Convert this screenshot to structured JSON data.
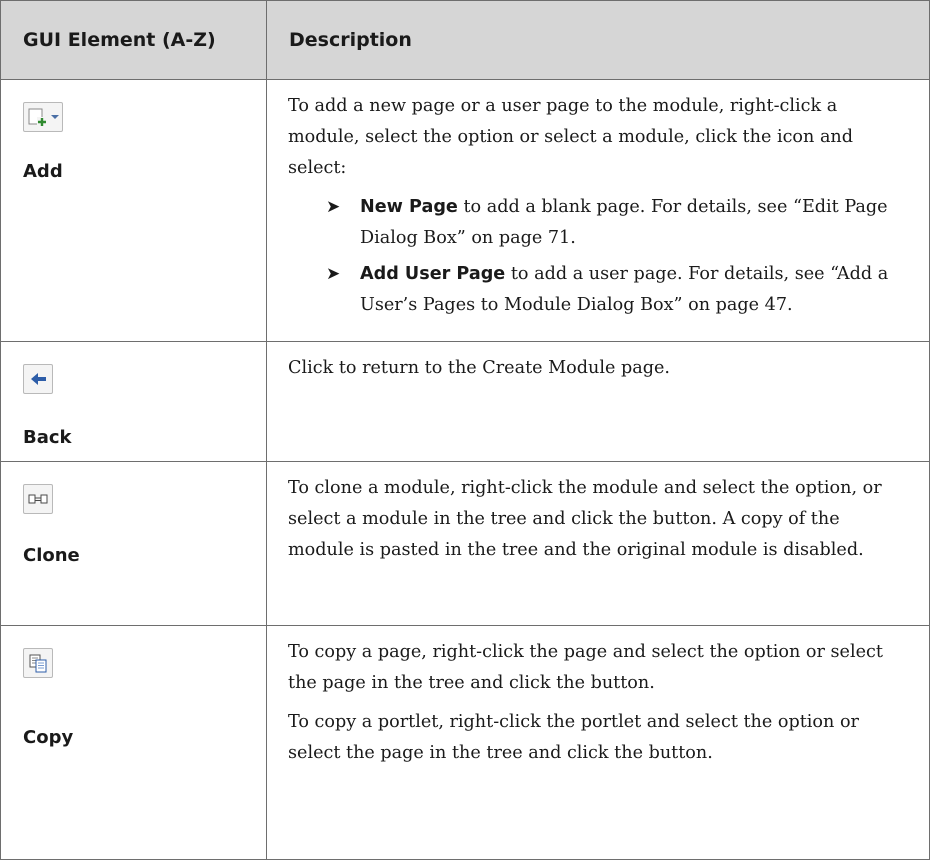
{
  "table": {
    "headers": {
      "element": "GUI Element (A-Z)",
      "description": "Description"
    },
    "rows": [
      {
        "name": "Add",
        "icon": "add-page-dropdown-icon",
        "intro": "To add a new page or a user page to the module, right-click a module, select the option or select a module, click the icon and select:",
        "bullets": [
          {
            "bold": "New Page",
            "text": " to add a blank page. For details, see “Edit Page Dialog Box” on page 71."
          },
          {
            "bold": "Add User Page",
            "text": " to add a user page. For details, see “Add a User’s Pages to Module Dialog Box” on page 47."
          }
        ]
      },
      {
        "name": "Back",
        "icon": "back-arrow-icon",
        "text": "Click to return to the Create Module page."
      },
      {
        "name": "Clone",
        "icon": "clone-icon",
        "text": "To clone a module, right-click the module and select the option, or select a module in the tree and click the button. A copy of the module is pasted in the tree and the original module is disabled."
      },
      {
        "name": "Copy",
        "icon": "copy-icon",
        "paragraphs": [
          "To copy a page, right-click the page and select the option or select the page in the tree and click the button.",
          "To copy a portlet, right-click the portlet and select the option or select the page in the tree and click the button."
        ]
      }
    ]
  }
}
